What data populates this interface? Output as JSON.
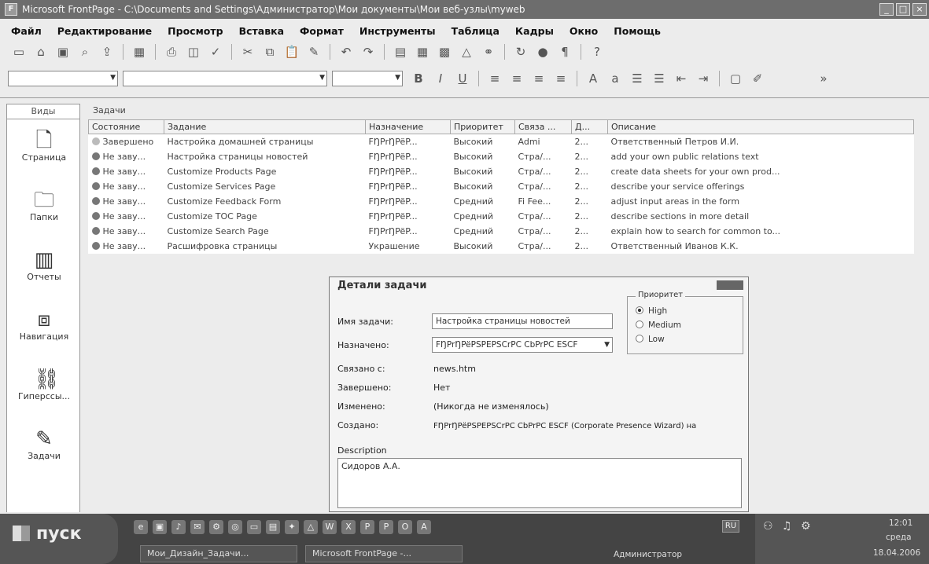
{
  "window": {
    "title": "Microsoft FrontPage - C:\\Documents and Settings\\Администратор\\Мои документы\\Мои веб-узлы\\myweb"
  },
  "menu": [
    "Файл",
    "Редактирование",
    "Просмотр",
    "Вставка",
    "Формат",
    "Инструменты",
    "Таблица",
    "Кадры",
    "Окно",
    "Помощь"
  ],
  "views": {
    "header": "Виды",
    "items": [
      {
        "label": "Страница",
        "icon": "page-icon"
      },
      {
        "label": "Папки",
        "icon": "folders-icon"
      },
      {
        "label": "Отчеты",
        "icon": "reports-icon"
      },
      {
        "label": "Навигация",
        "icon": "navigation-icon"
      },
      {
        "label": "Гиперссы...",
        "icon": "hyperlinks-icon"
      },
      {
        "label": "Задачи",
        "icon": "tasks-icon"
      }
    ]
  },
  "tasks": {
    "header": "Задачи",
    "columns": [
      "Состояние",
      "Задание",
      "Назначение",
      "Приоритет",
      "Связа ...",
      "Д...",
      "Описание"
    ],
    "rows": [
      {
        "status": "Завершено",
        "task": "Настройка домашней страницы",
        "assigned": "FŊPrŊPëP...",
        "priority": "Высокий",
        "linked": "Admi",
        "date": "2...",
        "desc": "Ответственный Петров И.И."
      },
      {
        "status": "Не заву...",
        "task": "Настройка страницы новостей",
        "assigned": "FŊPrŊPëP...",
        "priority": "Высокий",
        "linked": "Стра/...",
        "date": "2...",
        "desc": "add your own public relations text"
      },
      {
        "status": "Не заву...",
        "task": "Customize Products Page",
        "assigned": "FŊPrŊPëP...",
        "priority": "Высокий",
        "linked": "Стра/...",
        "date": "2...",
        "desc": "create data sheets for your own prod..."
      },
      {
        "status": "Не заву...",
        "task": "Customize Services Page",
        "assigned": "FŊPrŊPëP...",
        "priority": "Высокий",
        "linked": "Стра/...",
        "date": "2...",
        "desc": "describe your service offerings"
      },
      {
        "status": "Не заву...",
        "task": "Customize Feedback Form",
        "assigned": "FŊPrŊPëP...",
        "priority": "Средний",
        "linked": "Fi Fee...",
        "date": "2...",
        "desc": "adjust input areas in the form"
      },
      {
        "status": "Не заву...",
        "task": "Customize TOC Page",
        "assigned": "FŊPrŊPëP...",
        "priority": "Средний",
        "linked": "Стра/...",
        "date": "2...",
        "desc": "describe sections in more detail"
      },
      {
        "status": "Не заву...",
        "task": "Customize Search Page",
        "assigned": "FŊPrŊPëP...",
        "priority": "Средний",
        "linked": "Стра/...",
        "date": "2...",
        "desc": "explain how to search for common to..."
      },
      {
        "status": "Не заву...",
        "task": "Расшифровка страницы",
        "assigned": "Украшение",
        "priority": "Высокий",
        "linked": "Стра/...",
        "date": "2...",
        "desc": "Ответственный Иванов К.К."
      }
    ]
  },
  "dialog": {
    "title": "Детали задачи",
    "task_name_label": "Имя задачи:",
    "task_name_value": "Настройка страницы новостей",
    "assigned_label": "Назначено:",
    "assigned_value": "FŊPrŊPëPSPEPSCrPC CbPrPC ESCF",
    "created_label": "Связано с:",
    "created_value": "news.htm",
    "completed_label": "Завершено:",
    "completed_value": "Нет",
    "modified_label": "Изменено:",
    "modified_value": "(Никогда не изменялось)",
    "created_by_label": "Создано:",
    "created_by_value": "FŊPrŊPëPSPEPSCrPC CbPrPC ESCF (Corporate Presence Wizard) на",
    "priority_legend": "Приоритет",
    "priorities": [
      "High",
      "Medium",
      "Low"
    ],
    "description_label": "Description",
    "description_value": "Сидоров А.А."
  },
  "taskbar": {
    "start": "пуск",
    "buttons": [
      "Мои_Дизайн_Задачи...",
      "Microsoft FrontPage -..."
    ],
    "user": "Администратор",
    "lang": "RU",
    "time": "12:01",
    "day": "среда",
    "date": "18.04.2006"
  }
}
